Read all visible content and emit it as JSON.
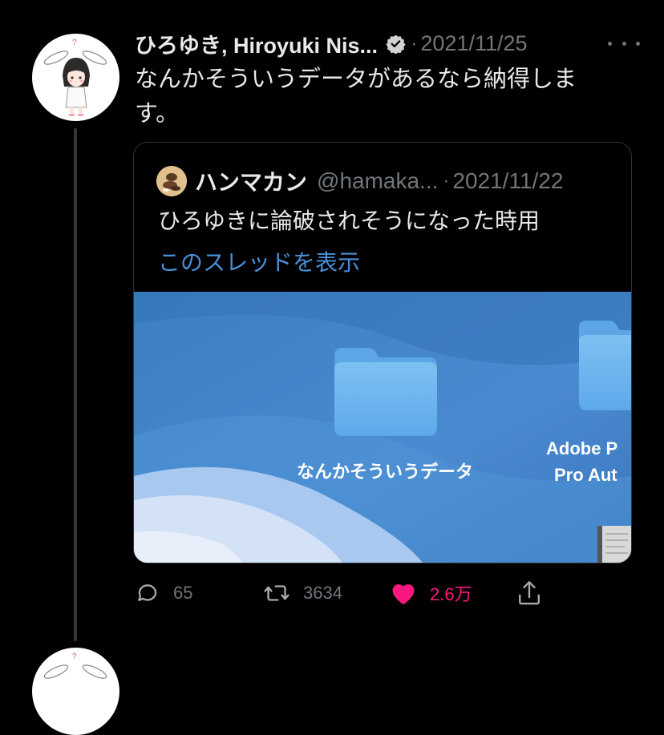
{
  "tweet": {
    "author": "ひろゆき, Hiroyuki Nis...",
    "verified": true,
    "separator": "·",
    "date": "2021/11/25",
    "text": "なんかそういうデータがあるなら納得しま す。"
  },
  "quoted_tweet": {
    "author": "ハンマカン",
    "handle": "@hamaka...",
    "separator": "·",
    "date": "2021/11/22",
    "text": "ひろゆきに論破されそうになった時用",
    "show_thread_label": "このスレッドを表示",
    "image": {
      "folder1_label": "なんかそういうデータ",
      "folder2_label_line1": "Adobe P",
      "folder2_label_line2": "Pro Aut"
    }
  },
  "actions": {
    "reply_count": "65",
    "retweet_count": "3634",
    "like_count": "2.6万",
    "like_active": true
  },
  "colors": {
    "background": "#000000",
    "text": "#e7e9ea",
    "muted": "#71767b",
    "link": "#4a90d9",
    "like": "#f91880"
  },
  "icons": [
    "more-icon",
    "verified-icon",
    "reply-icon",
    "retweet-icon",
    "like-icon",
    "share-icon",
    "folder-icon"
  ]
}
